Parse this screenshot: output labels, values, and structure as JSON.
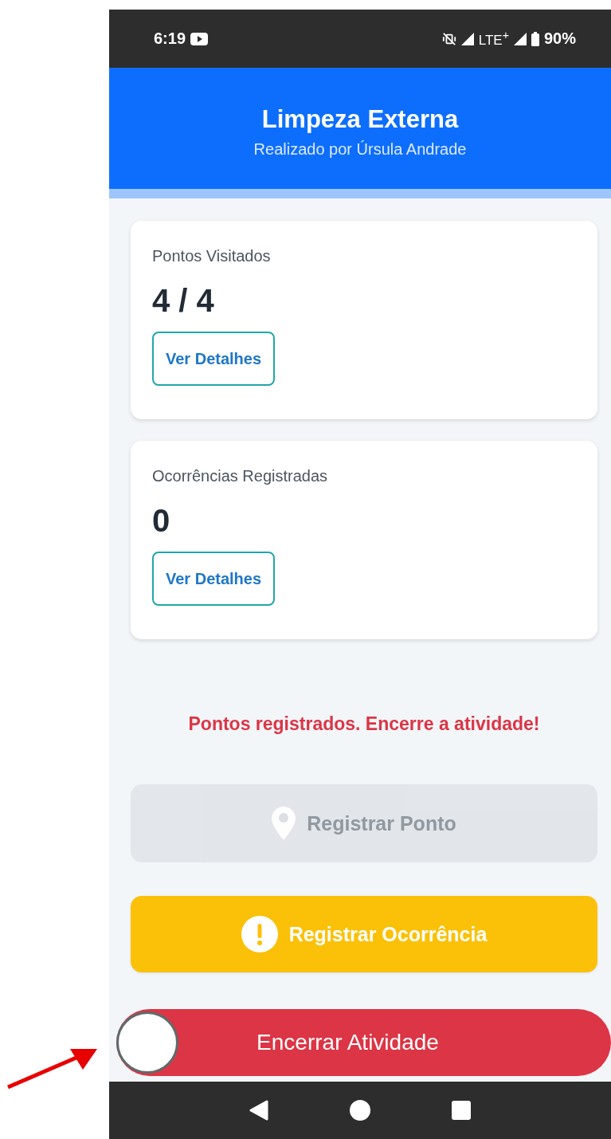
{
  "status_bar": {
    "time": "6:19",
    "network": "LTE$^{+}$",
    "battery": "90%"
  },
  "header": {
    "title": "Limpeza Externa",
    "subtitle": "Realizado por Úrsula Andrade"
  },
  "cards": [
    {
      "label": "Pontos Visitados",
      "value": "4 / 4",
      "button": "Ver Detalhes"
    },
    {
      "label": "Ocorrências Registradas",
      "value": "0",
      "button": "Ver Detalhes"
    }
  ],
  "message": "Pontos registrados. Encerre a atividade!",
  "actions": [
    {
      "kind": "point",
      "label": "Registrar Ponto",
      "disabled": true
    },
    {
      "kind": "occurrence",
      "label": "Registrar Ocorrência",
      "disabled": false
    }
  ],
  "slider": {
    "label": "Encerrar Atividade",
    "level": 0
  }
}
